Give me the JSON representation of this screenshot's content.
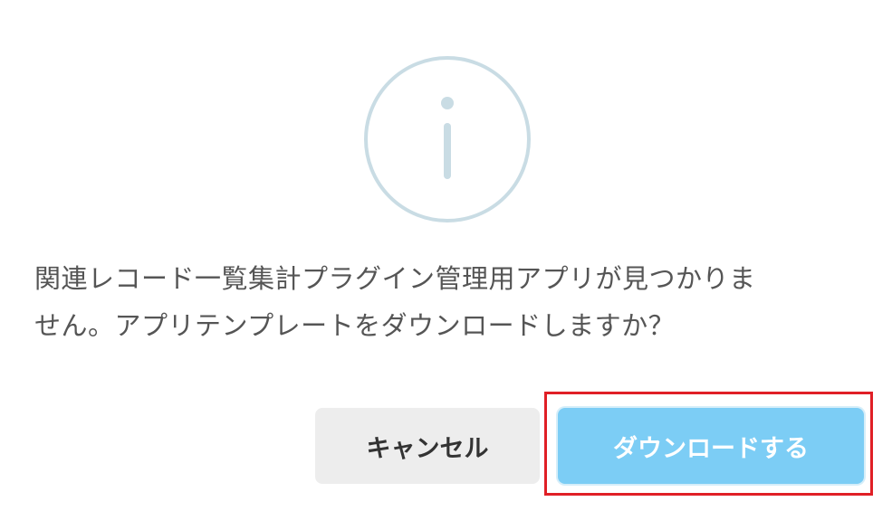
{
  "dialog": {
    "icon": "info-icon",
    "message_line1": "関連レコード一覧集計プラグイン管理用アプリが見つかりま",
    "message_line2": "せん。アプリテンプレートをダウンロードしますか？",
    "cancel_label": "キャンセル",
    "download_label": "ダウンロードする"
  },
  "colors": {
    "icon_stroke": "#c9dce4",
    "primary_button": "#7ccdf5",
    "cancel_button": "#ededed",
    "highlight": "#e01f26",
    "message_text": "#555555"
  }
}
